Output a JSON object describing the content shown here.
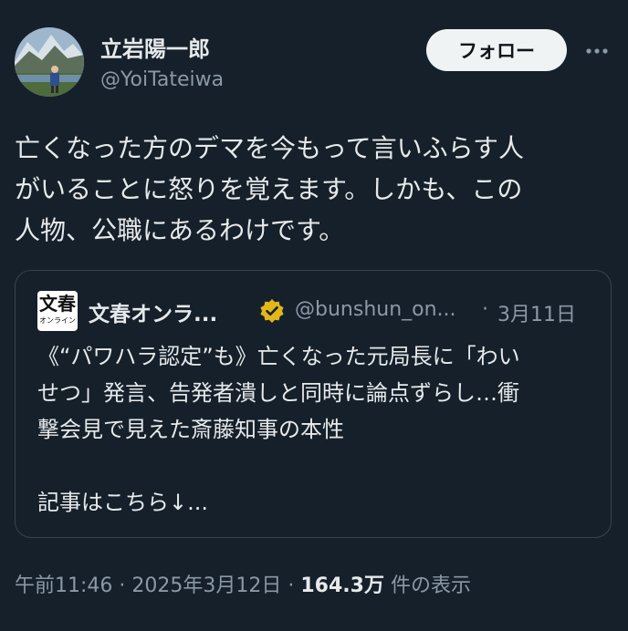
{
  "author": {
    "name": "立岩陽一郎",
    "handle": "@YoiTateiwa"
  },
  "follow_label": "フォロー",
  "tweet": {
    "text": "亡くなった方のデマを今もって言いふらす人\nがいることに怒りを覚えます。しかも、この\n人物、公職にあるわけです。"
  },
  "quote": {
    "logo_main": "文春",
    "logo_sub": "オンライン",
    "name": "文春オンラ...",
    "handle": "@bunshun_on...",
    "separator": "·",
    "date": "3月11日",
    "text": "《“パワハラ認定”も》亡くなった元局長に「わい\nせつ」発言、告発者潰しと同時に論点ずらし…衝\n撃会見で見えた斎藤知事の本性\n\n記事はこちら↓..."
  },
  "meta": {
    "time": "午前11:46",
    "dot1": " · ",
    "date": "2025年3月12日",
    "dot2": " · ",
    "views": "164.3万",
    "views_label": " 件の表示"
  },
  "colors": {
    "background": "#15202b",
    "text": "#e7e9ea",
    "secondary": "#8b98a5",
    "border": "#38444d",
    "verified": "#e2b719"
  },
  "icons": {
    "more": "more-horizontal-icon",
    "verified": "verified-badge-icon"
  }
}
